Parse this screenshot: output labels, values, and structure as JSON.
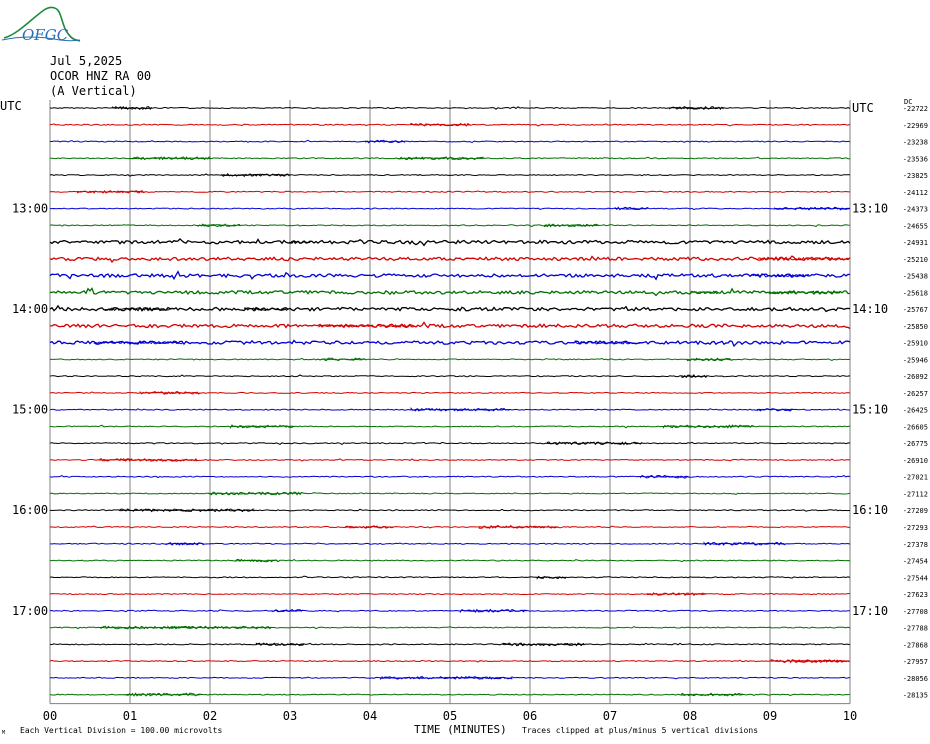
{
  "logo": {
    "text": "OFGC",
    "color": "#2a6db5",
    "mountain_color": "#1e8a3c"
  },
  "header": {
    "date": "Jul 5,2025",
    "station": "OCOR HNZ RA 00",
    "component": "(A Vertical)"
  },
  "chart_data": {
    "type": "line",
    "title": "",
    "xlabel": "TIME (MINUTES)",
    "ylabel": "",
    "xlim": [
      0,
      10
    ],
    "x_ticks": [
      "00",
      "01",
      "02",
      "03",
      "04",
      "05",
      "06",
      "07",
      "08",
      "09",
      "10"
    ],
    "grid": true,
    "left_axis_label": "UTC",
    "right_axis_label": "UTC",
    "right_axis_top_mark": "DC",
    "left_time_labels": [
      {
        "row": 6,
        "label": "13:00"
      },
      {
        "row": 12,
        "label": "14:00"
      },
      {
        "row": 18,
        "label": "15:00"
      },
      {
        "row": 24,
        "label": "16:00"
      },
      {
        "row": 30,
        "label": "17:00"
      }
    ],
    "right_time_labels": [
      {
        "row": 0,
        "label": "UTC"
      },
      {
        "row": 6,
        "label": "13:10"
      },
      {
        "row": 12,
        "label": "14:10"
      },
      {
        "row": 18,
        "label": "15:10"
      },
      {
        "row": 24,
        "label": "16:10"
      },
      {
        "row": 30,
        "label": "17:10"
      }
    ],
    "trace_colors": [
      "#000000",
      "#d40000",
      "#0000d4",
      "#007000"
    ],
    "trace_count": 36,
    "dc_offsets": [
      -22722,
      -22969,
      -23238,
      -23536,
      -23825,
      -24112,
      -24373,
      -24655,
      -24931,
      -25210,
      -25438,
      -25618,
      -25767,
      -25850,
      -25910,
      -25946,
      -26092,
      -26257,
      -26425,
      -26605,
      -26775,
      -26910,
      -27021,
      -27112,
      -27209,
      -27293,
      -27378,
      -27454,
      -27544,
      -27623,
      -27708,
      -27788,
      -27868,
      -27957,
      -28056,
      -28135
    ],
    "active_rows": [
      8,
      9,
      10,
      11,
      12,
      13,
      14
    ],
    "footer_left": "Each Vertical Division =  100.00 microvolts",
    "footer_right": "Traces clipped at plus/minus 5 vertical divisions"
  }
}
